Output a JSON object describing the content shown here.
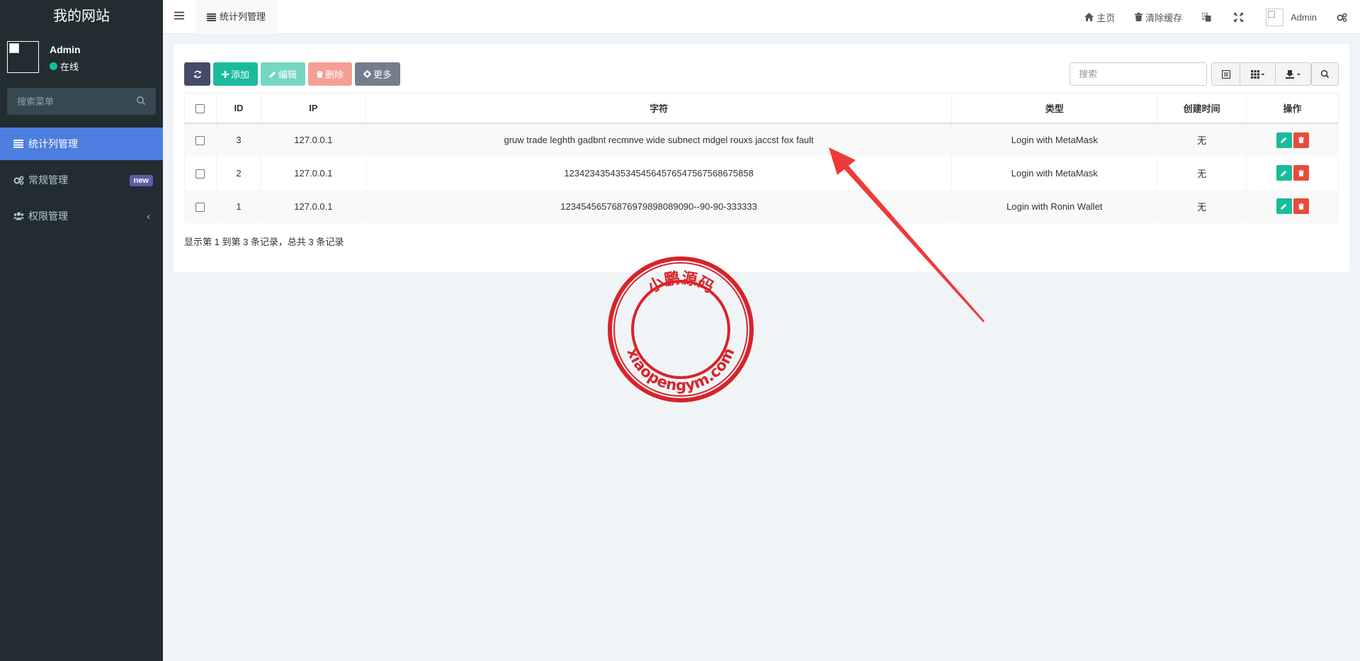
{
  "sidebar": {
    "site_title": "我的网站",
    "user_name": "Admin",
    "user_status": "在线",
    "search_placeholder": "搜索菜单",
    "items": [
      {
        "label": "统计列管理",
        "icon": "list-icon",
        "active": true
      },
      {
        "label": "常规管理",
        "icon": "cogs-icon",
        "badge": "new"
      },
      {
        "label": "权限管理",
        "icon": "users-icon",
        "chevron": "‹"
      }
    ]
  },
  "header": {
    "tab_label": "统计列管理",
    "home": "主页",
    "clear_cache": "清除缓存",
    "admin": "Admin"
  },
  "toolbar": {
    "add": "添加",
    "edit": "编辑",
    "delete": "删除",
    "more": "更多",
    "search_placeholder": "搜索"
  },
  "table": {
    "headers": [
      "ID",
      "IP",
      "字符",
      "类型",
      "创建时间",
      "操作"
    ],
    "rows": [
      {
        "id": "3",
        "ip": "127.0.0.1",
        "text": "gruw trade leghth gadbnt recmnve wide subnect mdgel rouxs jaccst fox fault",
        "type": "Login with MetaMask",
        "created": "无"
      },
      {
        "id": "2",
        "ip": "127.0.0.1",
        "text": "1234234354353454564576547567568675858",
        "type": "Login with MetaMask",
        "created": "无"
      },
      {
        "id": "1",
        "ip": "127.0.0.1",
        "text": "12345456576876979898089090--90-90-333333",
        "type": "Login with Ronin Wallet",
        "created": "无"
      }
    ]
  },
  "summary": "显示第 1 到第 3 条记录，总共 3 条记录",
  "stamp": {
    "top_text": "小鹏源码",
    "bottom_text": "xiaopengym.com",
    "color": "#d8232a"
  },
  "colors": {
    "sidebar_bg": "#222d32",
    "active_menu": "#4d7ee0",
    "success": "#18bc9c",
    "danger": "#e74c3c",
    "arrow": "#ee3a3a"
  }
}
